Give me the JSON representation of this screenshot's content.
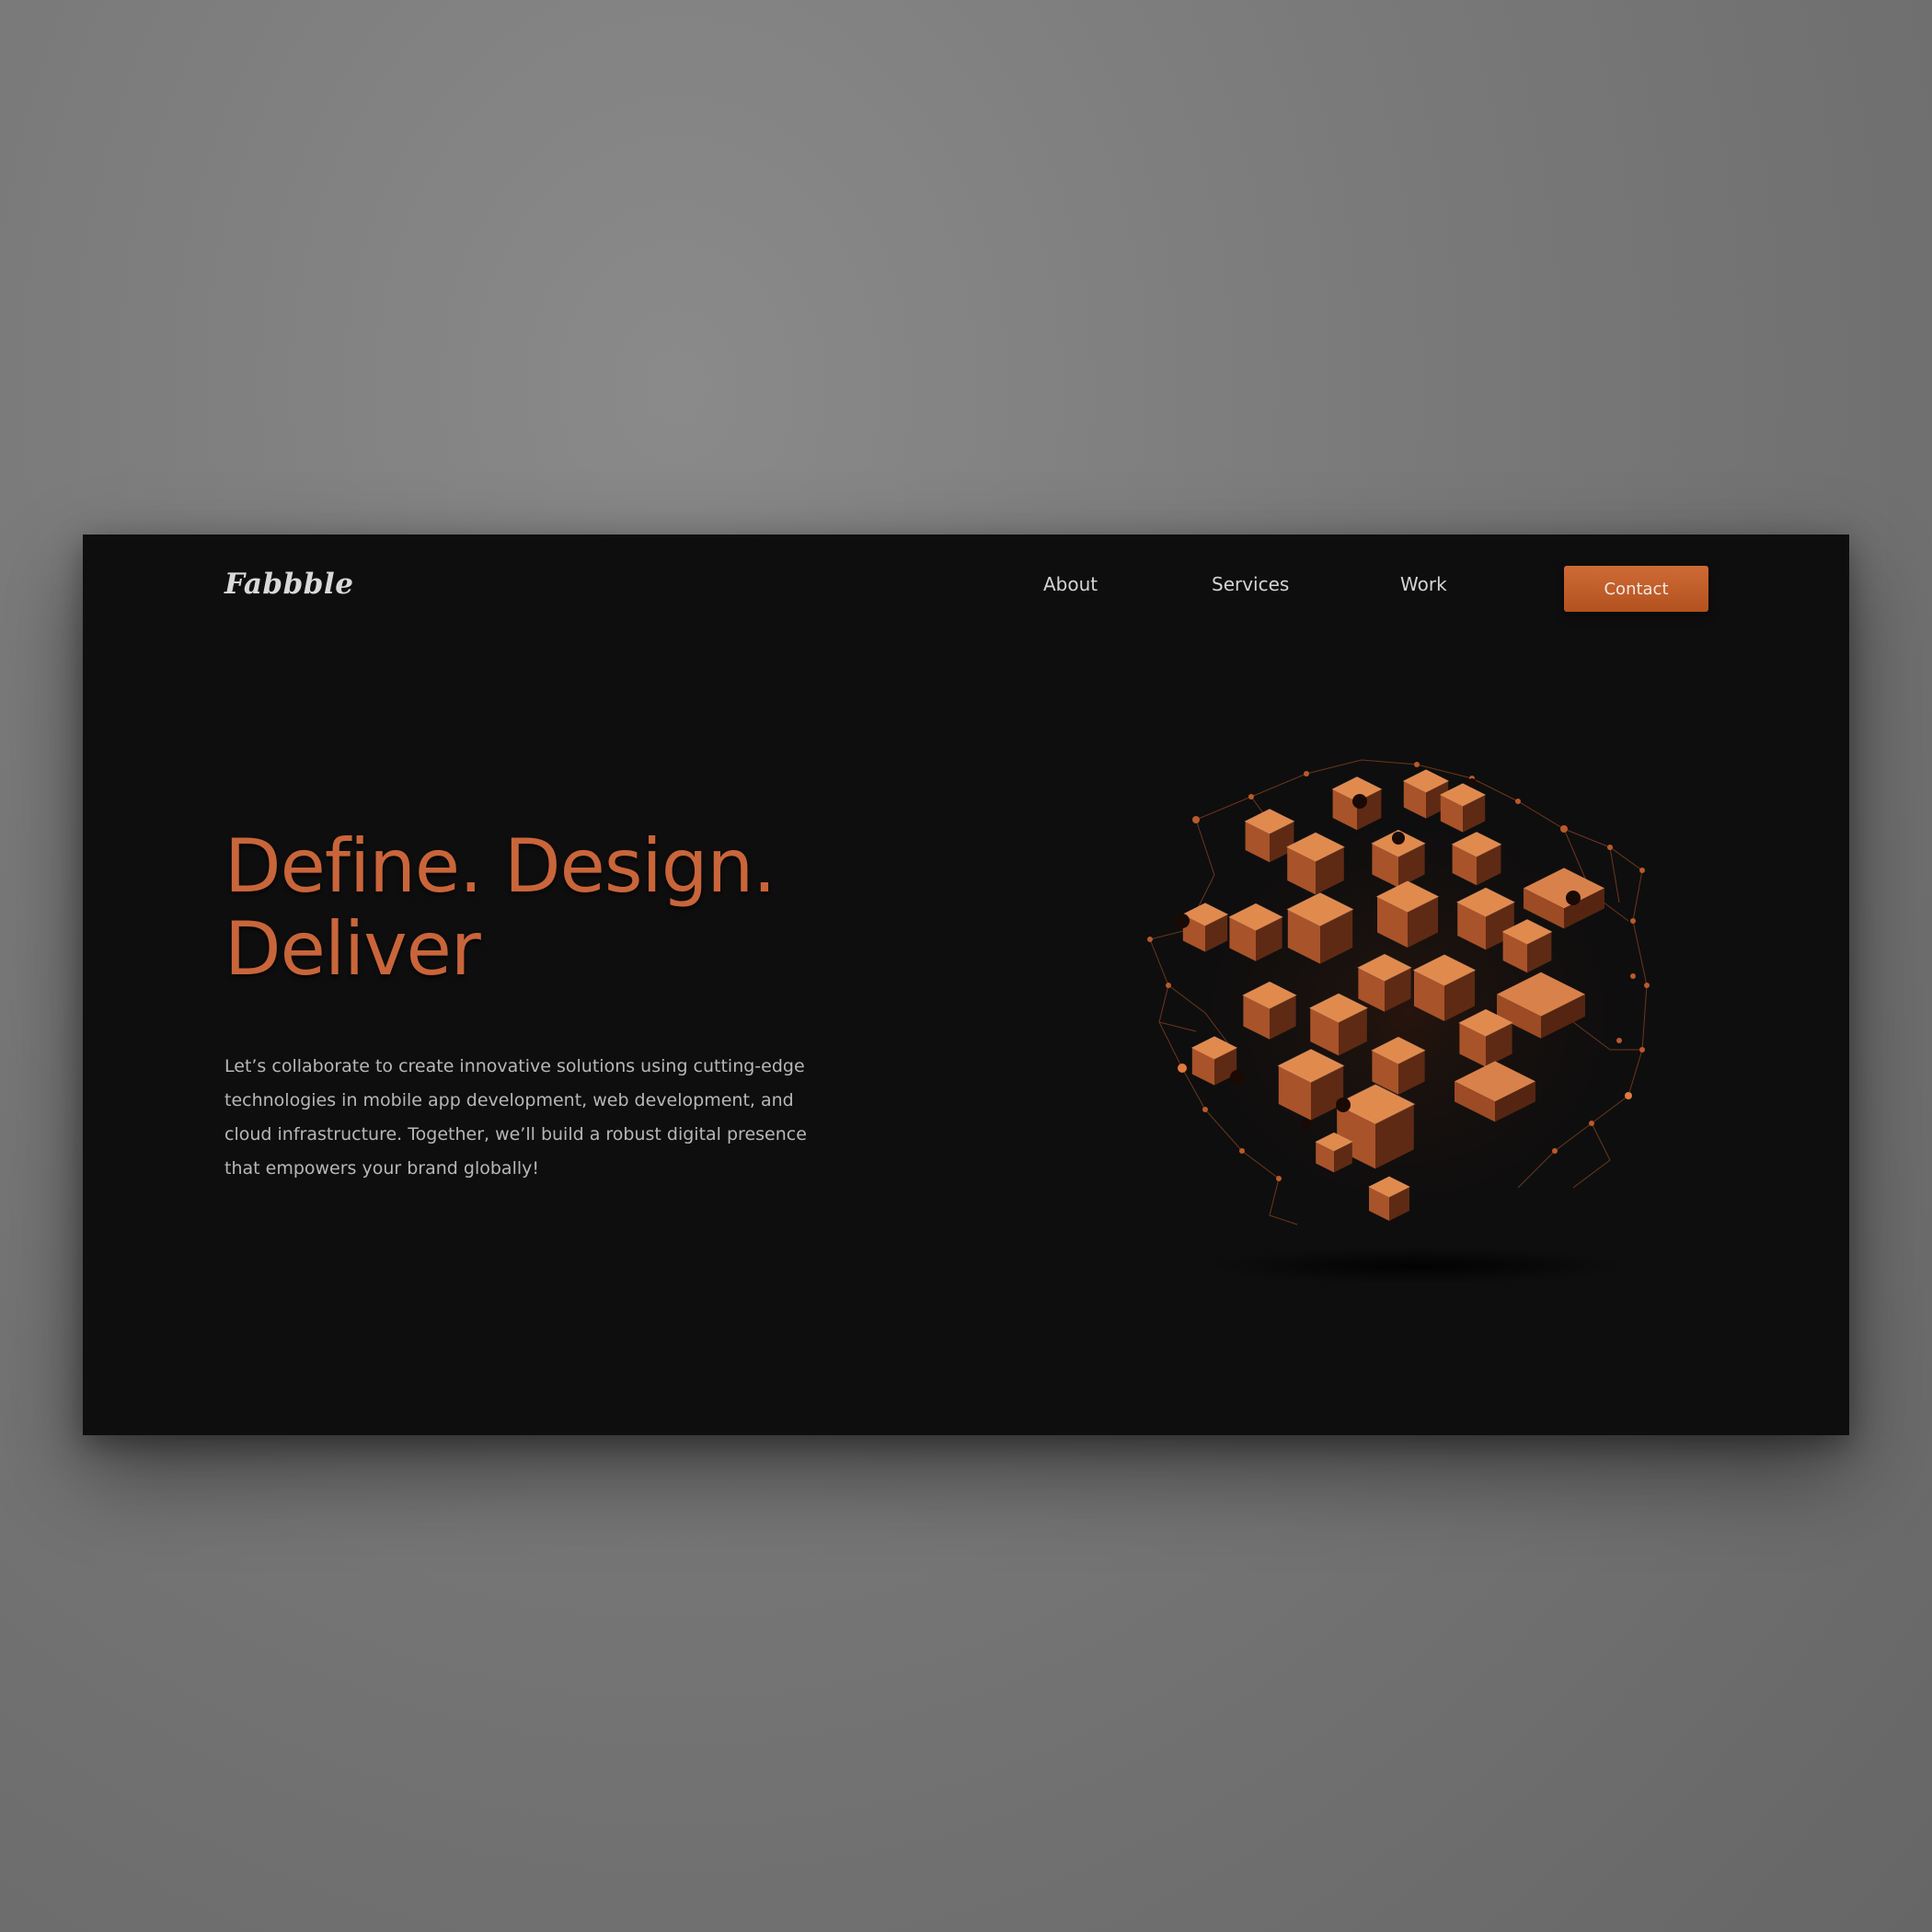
{
  "brand": {
    "name": "Fabbble"
  },
  "nav": {
    "links": [
      {
        "label": "About"
      },
      {
        "label": "Services"
      },
      {
        "label": "Work"
      }
    ],
    "cta_label": "Contact"
  },
  "hero": {
    "title_line1": "Define. Design.",
    "title_line2": "Deliver",
    "description": "Let’s collaborate to create innovative solutions using cutting-edge technologies in mobile app development, web development, and cloud infrastructure. Together, we’ll build a robust digital presence that empowers your brand globally!"
  },
  "illustration": {
    "name": "abstract-cube-cluster"
  },
  "colors": {
    "page_background": "#0e0e0e",
    "accent": "#c9653a",
    "button": "#c45f2b",
    "text_light": "#d4d4d4",
    "text_muted": "#b7b7b7"
  }
}
